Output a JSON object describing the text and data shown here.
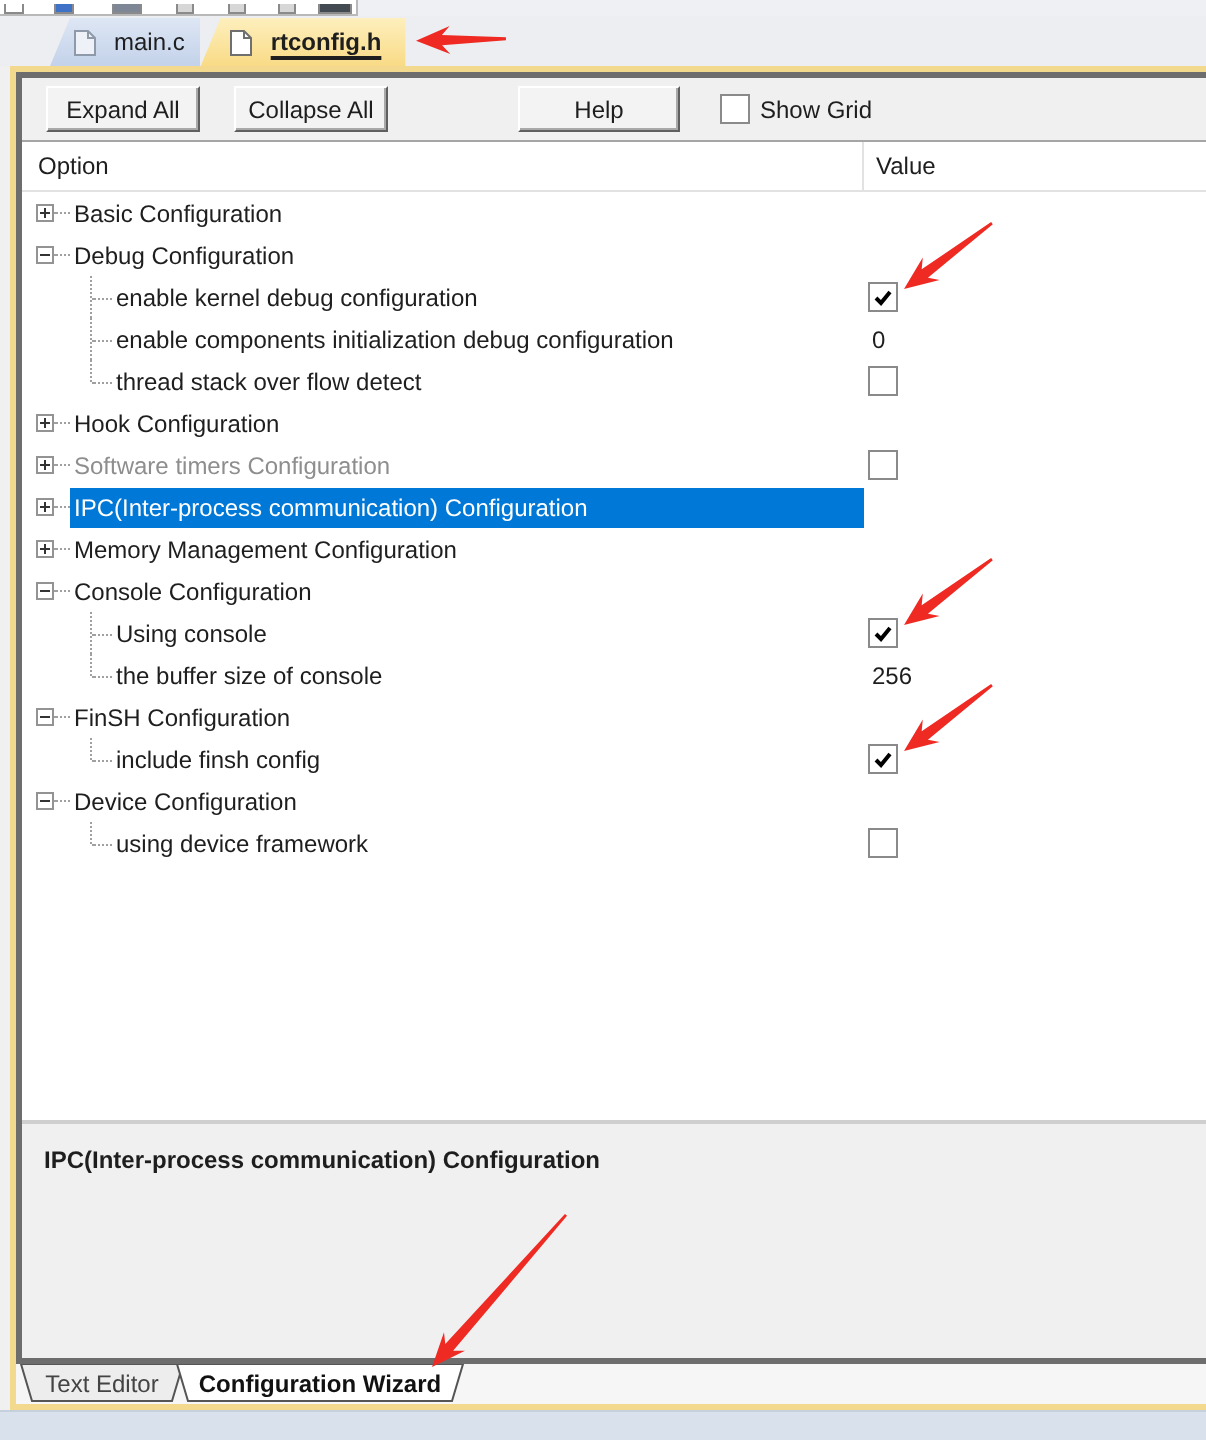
{
  "file_tabs": [
    {
      "label": "main.c",
      "selected": false,
      "arrow": false
    },
    {
      "label": "rtconfig.h",
      "selected": true,
      "arrow": true
    }
  ],
  "toolbar": {
    "buttons": [
      "Expand All",
      "Collapse All",
      "Help"
    ],
    "show_grid": {
      "label": "Show Grid",
      "checked": false
    }
  },
  "table": {
    "columns": [
      "Option",
      "Value"
    ],
    "rows": [
      {
        "label": "Basic Configuration",
        "expanded": false,
        "selected": false,
        "disabled": false,
        "arrow": false
      },
      {
        "label": "Debug Configuration",
        "expanded": true,
        "selected": false,
        "disabled": false,
        "arrow": false,
        "children": [
          {
            "label": "enable kernel debug configuration",
            "selected": false,
            "disabled": false,
            "arrow": true,
            "value": {
              "kind": "checkbox",
              "checked": true
            }
          },
          {
            "label": "enable components initialization debug configuration",
            "selected": false,
            "disabled": false,
            "arrow": false,
            "value": {
              "kind": "text",
              "text": "0"
            }
          },
          {
            "label": "thread stack over flow detect",
            "selected": false,
            "disabled": false,
            "arrow": false,
            "value": {
              "kind": "checkbox",
              "checked": false
            }
          }
        ]
      },
      {
        "label": "Hook Configuration",
        "expanded": false,
        "selected": false,
        "disabled": false,
        "arrow": false
      },
      {
        "label": "Software timers Configuration",
        "expanded": false,
        "selected": false,
        "disabled": true,
        "arrow": false,
        "value": {
          "kind": "checkbox",
          "checked": false
        }
      },
      {
        "label": "IPC(Inter-process communication) Configuration",
        "expanded": false,
        "selected": true,
        "disabled": false,
        "arrow": false
      },
      {
        "label": "Memory Management Configuration",
        "expanded": false,
        "selected": false,
        "disabled": false,
        "arrow": false
      },
      {
        "label": "Console Configuration",
        "expanded": true,
        "selected": false,
        "disabled": false,
        "arrow": false,
        "children": [
          {
            "label": "Using console",
            "selected": false,
            "disabled": false,
            "arrow": true,
            "value": {
              "kind": "checkbox",
              "checked": true
            }
          },
          {
            "label": "the buffer size of console",
            "selected": false,
            "disabled": false,
            "arrow": false,
            "value": {
              "kind": "text",
              "text": "256"
            }
          }
        ]
      },
      {
        "label": "FinSH Configuration",
        "expanded": true,
        "selected": false,
        "disabled": false,
        "arrow": false,
        "children": [
          {
            "label": "include finsh config",
            "selected": false,
            "disabled": false,
            "arrow": true,
            "value": {
              "kind": "checkbox",
              "checked": true
            }
          }
        ]
      },
      {
        "label": "Device Configuration",
        "expanded": true,
        "selected": false,
        "disabled": false,
        "arrow": false,
        "children": [
          {
            "label": "using device framework",
            "selected": false,
            "disabled": false,
            "arrow": false,
            "value": {
              "kind": "checkbox",
              "checked": false
            }
          }
        ]
      }
    ]
  },
  "description": "IPC(Inter-process communication) Configuration",
  "bottom_tabs": [
    {
      "label": "Text Editor",
      "selected": false,
      "arrow": false
    },
    {
      "label": "Configuration Wizard",
      "selected": true,
      "arrow": true
    }
  ]
}
